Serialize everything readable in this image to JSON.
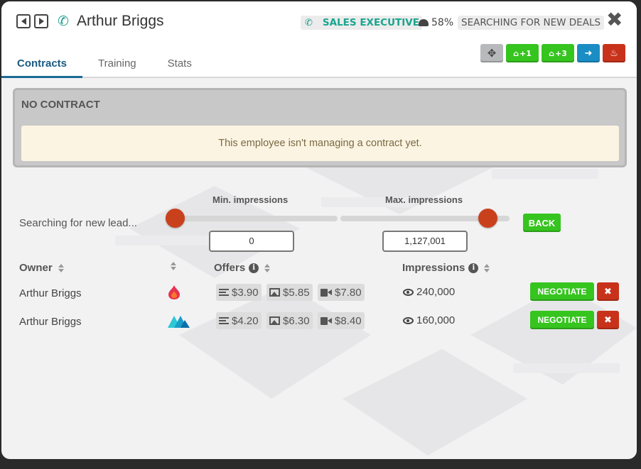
{
  "header": {
    "name": "Arthur Briggs",
    "role": "SALES EXECUTIVE",
    "workload": "58%",
    "status": "SEARCHING FOR NEW DEALS"
  },
  "toolbar": {
    "add_one_label": "+1",
    "add_three_label": "+3"
  },
  "tabs": [
    {
      "label": "Contracts",
      "active": true
    },
    {
      "label": "Training",
      "active": false
    },
    {
      "label": "Stats",
      "active": false
    }
  ],
  "contract": {
    "title": "NO CONTRACT",
    "message": "This employee isn't managing a contract yet."
  },
  "search": {
    "label": "Searching for new lead...",
    "min_label": "Min. impressions",
    "max_label": "Max. impressions",
    "min_value": "0",
    "max_value": "1,127,001",
    "back_label": "BACK"
  },
  "table": {
    "headers": {
      "owner": "Owner",
      "offers": "Offers",
      "impressions": "Impressions"
    },
    "negotiate_label": "NEGOTIATE",
    "rows": [
      {
        "owner": "Arthur Briggs",
        "logo": "flame-logo-icon",
        "text_price": "$3.90",
        "image_price": "$5.85",
        "video_price": "$7.80",
        "impressions": "240,000"
      },
      {
        "owner": "Arthur Briggs",
        "logo": "mountain-logo-icon",
        "text_price": "$4.20",
        "image_price": "$6.30",
        "video_price": "$8.40",
        "impressions": "160,000"
      }
    ]
  },
  "colors": {
    "accent_green": "#36c41f",
    "teal": "#1aa58e",
    "danger": "#c8321a",
    "info_blue": "#1a8dc4",
    "tab_active": "#1a5a80"
  }
}
